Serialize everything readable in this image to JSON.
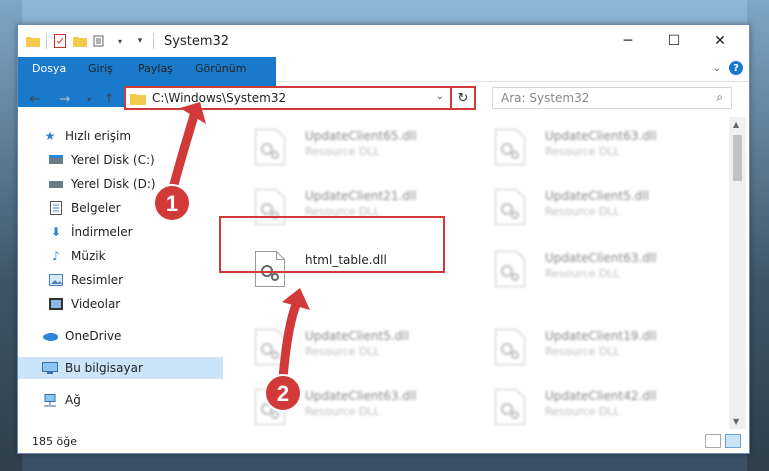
{
  "window": {
    "title": "System32"
  },
  "ribbon": {
    "tabs": [
      "Dosya",
      "Giriş",
      "Paylaş",
      "Görünüm"
    ]
  },
  "address": {
    "path": "C:\\Windows\\System32"
  },
  "search": {
    "placeholder": "Ara: System32"
  },
  "sidebar": {
    "items": [
      {
        "label": "Hızlı erişim"
      },
      {
        "label": "Yerel Disk (C:)"
      },
      {
        "label": "Yerel Disk (D:)"
      },
      {
        "label": "Belgeler"
      },
      {
        "label": "İndirmeler"
      },
      {
        "label": "Müzik"
      },
      {
        "label": "Resimler"
      },
      {
        "label": "Videolar"
      },
      {
        "label": "OneDrive"
      },
      {
        "label": "Bu bilgisayar"
      },
      {
        "label": "Ağ"
      }
    ]
  },
  "files": {
    "left": [
      {
        "name": "UpdateClient65.dll",
        "type": "Resource DLL"
      },
      {
        "name": "UpdateClient21.dll",
        "type": "Resource DLL"
      },
      {
        "name": "html_table.dll",
        "type": ""
      },
      {
        "name": "UpdateClient5.dll",
        "type": "Resource DLL"
      },
      {
        "name": "UpdateClient63.dll",
        "type": "Resource DLL"
      }
    ],
    "right": [
      {
        "name": "UpdateClient63.dll",
        "type": "Resource DLL"
      },
      {
        "name": "UpdateClient5.dll",
        "type": "Resource DLL"
      },
      {
        "name": "UpdateClient63.dll",
        "type": "Resource DLL"
      },
      {
        "name": "UpdateClient19.dll",
        "type": "Resource DLL"
      },
      {
        "name": "UpdateClient42.dll",
        "type": "Resource DLL"
      }
    ]
  },
  "status": {
    "count": "185 öğe"
  },
  "annotations": {
    "step1": "1",
    "step2": "2"
  },
  "colors": {
    "accent": "#1979ca",
    "highlight": "#d23a3a"
  }
}
